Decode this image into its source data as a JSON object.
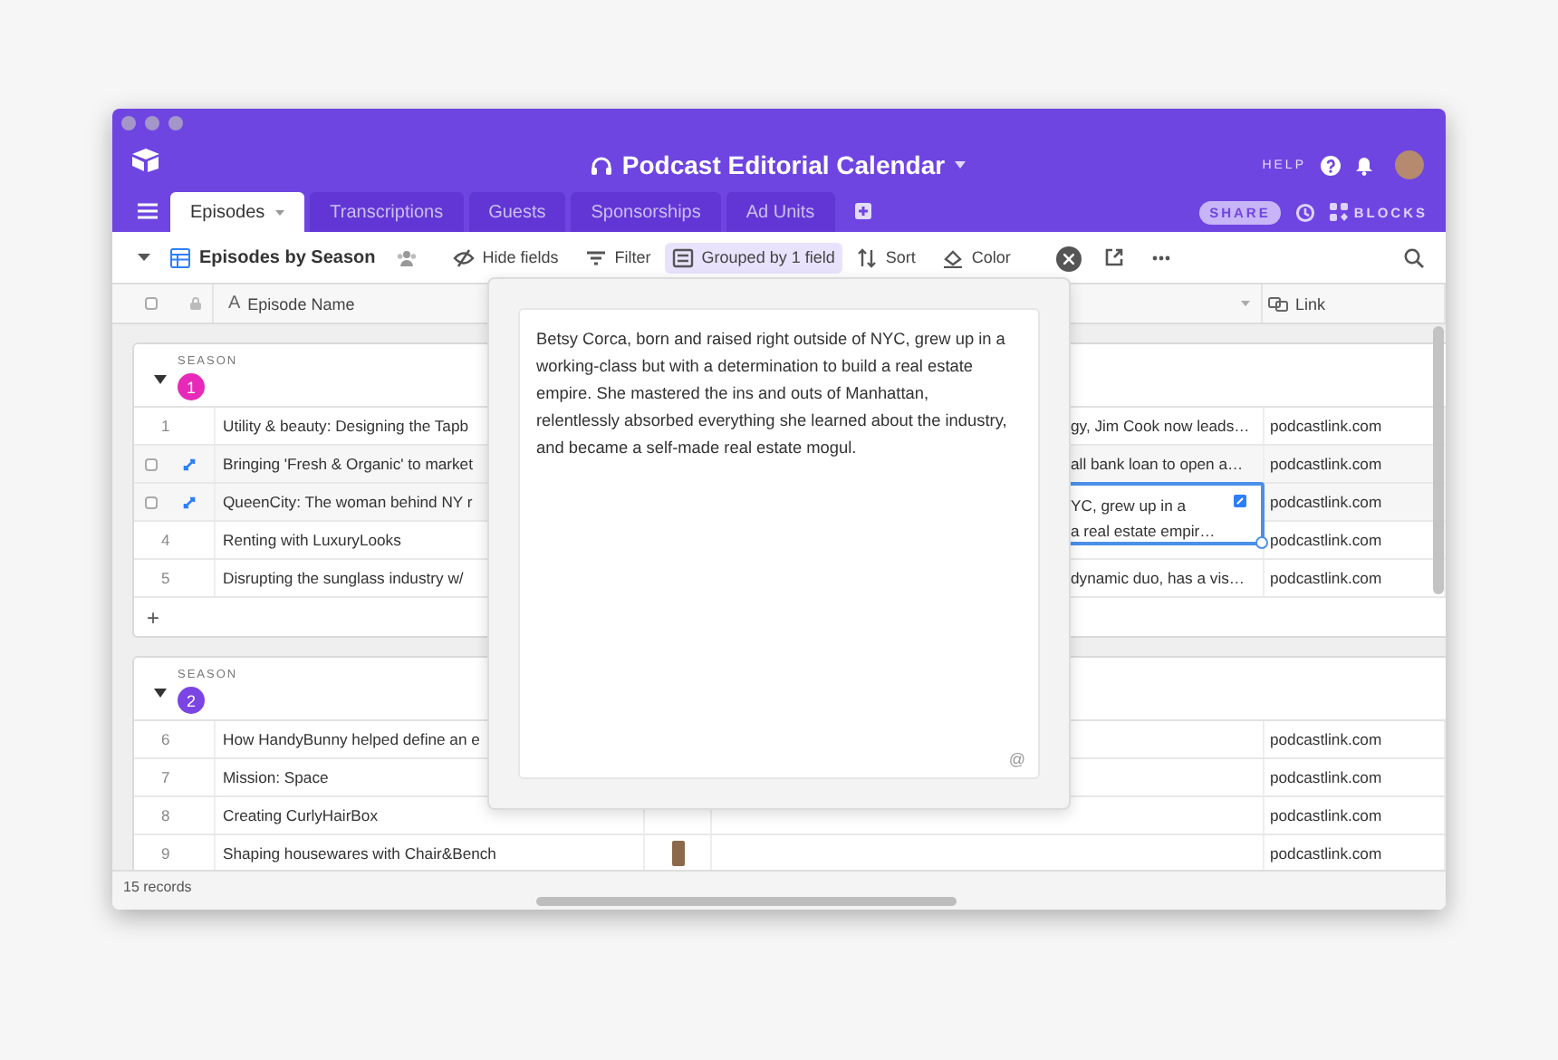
{
  "window": {
    "title": "Podcast Editorial Calendar",
    "help_label": "HELP"
  },
  "tabs": [
    {
      "label": "Episodes",
      "selected": true
    },
    {
      "label": "Transcriptions",
      "selected": false
    },
    {
      "label": "Guests",
      "selected": false
    },
    {
      "label": "Sponsorships",
      "selected": false
    },
    {
      "label": "Ad Units",
      "selected": false
    }
  ],
  "header_actions": {
    "share": "SHARE",
    "blocks": "BLOCKS"
  },
  "toolbar": {
    "view_name": "Episodes by Season",
    "buttons": [
      {
        "kind": "hide",
        "label": "Hide fields",
        "selected": false
      },
      {
        "kind": "filter",
        "label": "Filter",
        "selected": false
      },
      {
        "kind": "group",
        "label": "Grouped by 1 field",
        "selected": true
      },
      {
        "kind": "sort",
        "label": "Sort",
        "selected": false
      },
      {
        "kind": "color",
        "label": "Color",
        "selected": false
      }
    ]
  },
  "table": {
    "select_all": {
      "checked": false
    },
    "columns": [
      {
        "kind": "name",
        "type_icon": "A",
        "label": "Episode Name"
      },
      {
        "kind": "notes"
      },
      {
        "kind": "link",
        "label": "Link"
      }
    ],
    "groups": [
      {
        "label": "SEASON",
        "value": "1",
        "color": "#e629b8",
        "expanded": true,
        "add_label": "+",
        "rows": [
          {
            "number": "1",
            "hovered": false,
            "name": "Utility & beauty: Designing the Tapb",
            "notes": "gy, Jim Cook now leads…",
            "editing": false,
            "link": "podcastlink.com"
          },
          {
            "hovered": true,
            "name": "Bringing 'Fresh & Organic' to market",
            "notes": "all bank loan to open a…",
            "editing": false,
            "link": "podcastlink.com"
          },
          {
            "hovered": true,
            "name": "QueenCity: The woman behind NY r",
            "notes": "YC, grew up in a\na real estate empir…",
            "editing": true,
            "link": "podcastlink.com"
          },
          {
            "number": "4",
            "hovered": false,
            "name": "Renting with LuxuryLooks",
            "editing": false,
            "link": "podcastlink.com"
          },
          {
            "number": "5",
            "hovered": false,
            "name": "Disrupting the sunglass industry w/",
            "notes": "dynamic duo, has a vis…",
            "editing": false,
            "link": "podcastlink.com"
          }
        ]
      },
      {
        "label": "SEASON",
        "value": "2",
        "color": "#7b45e6",
        "expanded": true,
        "rows": [
          {
            "number": "6",
            "hovered": false,
            "name": "How HandyBunny helped define an e",
            "editing": false,
            "link": "podcastlink.com"
          },
          {
            "number": "7",
            "hovered": false,
            "name": "Mission: Space",
            "editing": false,
            "link": "podcastlink.com"
          },
          {
            "number": "8",
            "hovered": false,
            "name": "Creating CurlyHairBox",
            "editing": false,
            "thumbnail": false,
            "link": "podcastlink.com"
          },
          {
            "number": "9",
            "hovered": false,
            "name": "Shaping housewares with Chair&Bench",
            "editing": false,
            "thumbnail": true,
            "link": "podcastlink.com"
          }
        ]
      }
    ]
  },
  "popup": {
    "text": "Betsy Corca, born and raised right outside of NYC, grew up in a working-class but with a determination to build a real estate empire. She mastered the ins and outs of Manhattan, relentlessly absorbed everything she learned about the industry, and became a self-made real estate mogul.",
    "mention": "@"
  },
  "footer": {
    "record_count": "15 records"
  }
}
